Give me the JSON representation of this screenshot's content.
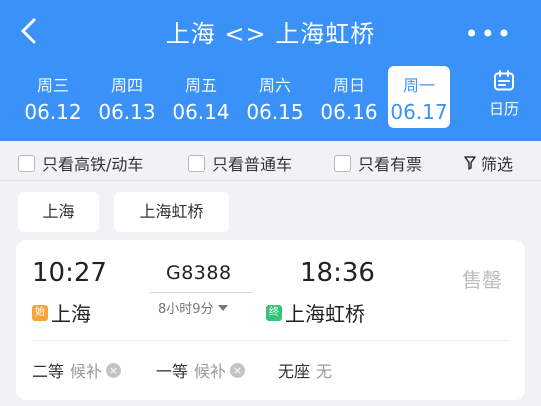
{
  "header": {
    "title": "上海 <> 上海虹桥",
    "more_glyph": "•••"
  },
  "dates": [
    {
      "weekday": "周三",
      "date": "06.12",
      "active": false
    },
    {
      "weekday": "周四",
      "date": "06.13",
      "active": false
    },
    {
      "weekday": "周五",
      "date": "06.14",
      "active": false
    },
    {
      "weekday": "周六",
      "date": "06.15",
      "active": false
    },
    {
      "weekday": "周日",
      "date": "06.16",
      "active": false
    },
    {
      "weekday": "周一",
      "date": "06.17",
      "active": true
    }
  ],
  "calendar": {
    "label": "日历",
    "icon": "calendar-icon"
  },
  "filters": {
    "high_speed": "只看高铁/动车",
    "regular": "只看普通车",
    "available": "只看有票",
    "filter": "筛选"
  },
  "station_chips": [
    "上海",
    "上海虹桥"
  ],
  "train": {
    "depart_time": "10:27",
    "train_no": "G8388",
    "arrive_time": "18:36",
    "status": "售罄",
    "duration": "8小时9分",
    "depart_tag": "始",
    "depart_station": "上海",
    "arrive_tag": "终",
    "arrive_station": "上海虹桥",
    "seats": [
      {
        "class": "二等",
        "availability": "候补"
      },
      {
        "class": "一等",
        "availability": "候补"
      },
      {
        "class": "无座",
        "availability": "无"
      }
    ]
  },
  "colors": {
    "brand_blue": "#3a91f7",
    "start_tag": "#f7a23a",
    "end_tag": "#34c47c"
  }
}
